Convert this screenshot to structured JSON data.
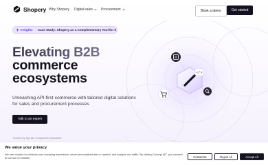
{
  "nav": {
    "logo_text": "Shopery",
    "links": [
      {
        "label": "Why Shopery",
        "has_dropdown": false
      },
      {
        "label": "Digital sales",
        "has_dropdown": true
      },
      {
        "label": "Procurement",
        "has_dropdown": true
      }
    ],
    "book_demo_label": "Book a demo",
    "get_started_label": "Get started"
  },
  "insight": {
    "tag": "Insights",
    "text": "Case Study: Shopery as a Complementary Tool for h"
  },
  "hero": {
    "title_line1": "Elevating B2B",
    "title_line2": "commerce",
    "title_line3": "ecosystems",
    "subtitle": "Unleashing API-first commerce with tailored digital solutions for sales and procurement processes",
    "cta_label": "Talk to an expert",
    "trusted_text": "Trusted by top-tier companies worldwide"
  },
  "illustration": {
    "icons": [
      "document-icon",
      "api-code-icon",
      "shopery-logo-tile",
      "cart-icon",
      "search-icon"
    ],
    "accent": "#8b6cf0"
  },
  "cookie": {
    "title": "We value your privacy",
    "text": "We use cookies to enhance your browsing experience, serve personalized ads or content, and analyze our traffic. By clicking \"Accept All\", you consent to our use of cookies.",
    "customize_label": "Customize",
    "reject_label": "Reject All",
    "accept_label": "Accept All"
  },
  "colors": {
    "primary_dark": "#141220",
    "accent_purple": "#6a45d9",
    "pill_bg": "#ede5fd"
  }
}
